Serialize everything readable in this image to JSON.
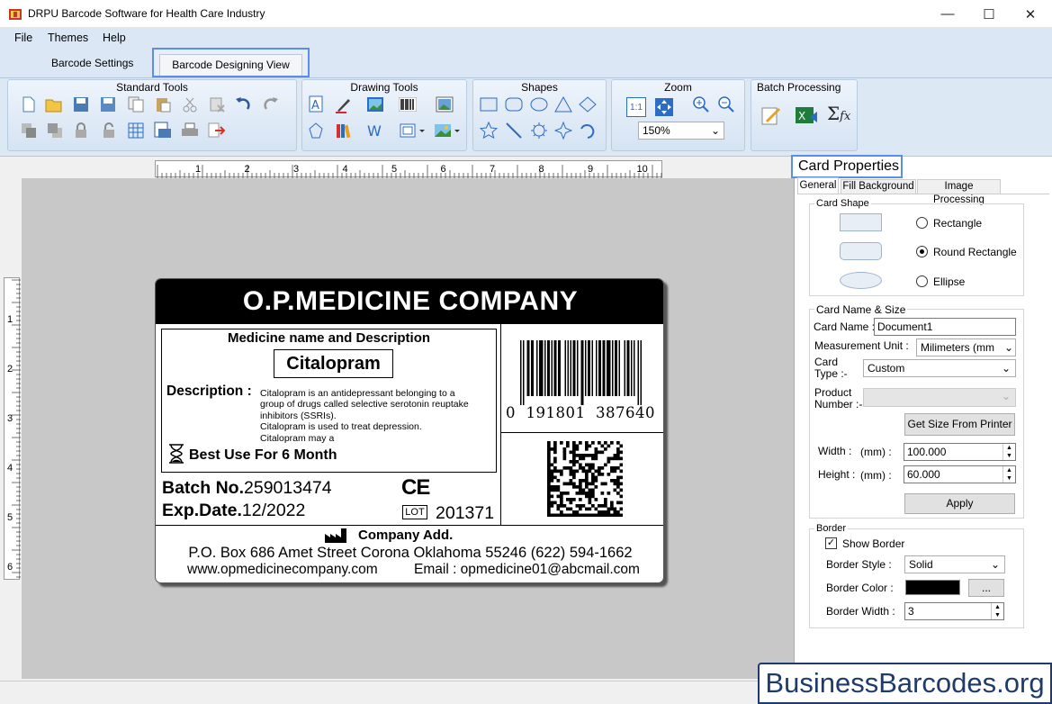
{
  "window": {
    "title": "DRPU Barcode Software for Health Care Industry",
    "min": "—",
    "max": "☐",
    "close": "✕"
  },
  "menu": [
    "File",
    "Themes",
    "Help"
  ],
  "tabs": {
    "settings": "Barcode Settings",
    "designing": "Barcode Designing View"
  },
  "ribbon": {
    "standard": "Standard Tools",
    "drawing": "Drawing Tools",
    "shapes": "Shapes",
    "zoom": "Zoom",
    "batch": "Batch Processing",
    "zoom_value": "150%",
    "zoom_11": "1:1"
  },
  "ruler": {
    "h": [
      "1",
      "2",
      "3",
      "4",
      "5",
      "6",
      "7",
      "8",
      "9",
      "10"
    ],
    "v": [
      "1",
      "2",
      "3",
      "4",
      "5",
      "6"
    ]
  },
  "card": {
    "header": "O.P.MEDICINE COMPANY",
    "box_title": "Medicine name and Description",
    "drug": "Citalopram",
    "desc_label": "Description :",
    "desc_lines": [
      "Citalopram is an antidepressant belonging to a",
      "group of drugs called selective serotonin reuptake",
      "inhibitors (SSRIs).",
      "Citalopram is used to treat depression.",
      "Citalopram may a"
    ],
    "best_use": "Best Use For 6 Month",
    "batch_label": "Batch No.",
    "batch": "259013474",
    "exp_label": "Exp.Date.",
    "exp": "12/2022",
    "ce": "CE",
    "lot": "LOT",
    "lot_no": "201371",
    "barcode_text": "0  191801  387640",
    "company_add": "Company Add.",
    "address": "P.O. Box 686 Amet Street Corona Oklahoma 55246 (622) 594-1662",
    "web": "www.opmedicinecompany.com",
    "email": "Email : opmedicine01@abcmail.com"
  },
  "panel": {
    "title": "Card Properties",
    "tabs": [
      "General",
      "Fill Background",
      "Image Processing"
    ],
    "card_shape": "Card Shape",
    "shapes": [
      "Rectangle",
      "Round Rectangle",
      "Ellipse"
    ],
    "name_size": "Card  Name & Size",
    "card_name_label": "Card Name :",
    "card_name": "Document1",
    "unit_label": "Measurement Unit :",
    "unit": "Milimeters (mm",
    "type_label_1": "Card",
    "type_label_2": "Type :-",
    "type": "Custom",
    "product_label_1": "Product",
    "product_label_2": "Number :-",
    "get_size": "Get Size From Printer",
    "width_label": "Width :",
    "height_label": "Height :",
    "mm": "(mm) :",
    "width": "100.000",
    "height": "60.000",
    "apply": "Apply",
    "border": "Border",
    "show_border": "Show Border",
    "border_style_label": "Border Style :",
    "border_style": "Solid",
    "border_color_label": "Border Color :",
    "dots": "...",
    "border_width_label": "Border Width :",
    "border_width": "3"
  },
  "watermark": "BusinessBarcodes.org"
}
